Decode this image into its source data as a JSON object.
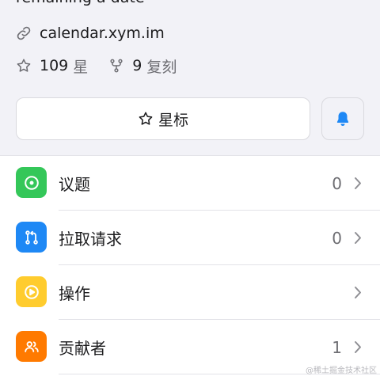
{
  "repo": {
    "description_cut": "remaining a date",
    "website": "calendar.xym.im",
    "stars_count": "109",
    "stars_unit": "星",
    "forks_count": "9",
    "forks_unit": "复刻"
  },
  "actions": {
    "star_label": "星标"
  },
  "list": [
    {
      "label": "议题",
      "count": "0",
      "icon": "issue-icon",
      "color": "#34c759"
    },
    {
      "label": "拉取请求",
      "count": "0",
      "icon": "pull-request-icon",
      "color": "#1e88f5"
    },
    {
      "label": "操作",
      "count": "",
      "icon": "play-icon",
      "color": "#ffcc2e"
    },
    {
      "label": "贡献者",
      "count": "1",
      "icon": "people-icon",
      "color": "#ff7a00"
    }
  ],
  "watermark": "@稀土掘金技术社区",
  "colors": {
    "accent": "#1e88f5",
    "muted": "#6e6e73",
    "background": "#f2f2f7"
  }
}
